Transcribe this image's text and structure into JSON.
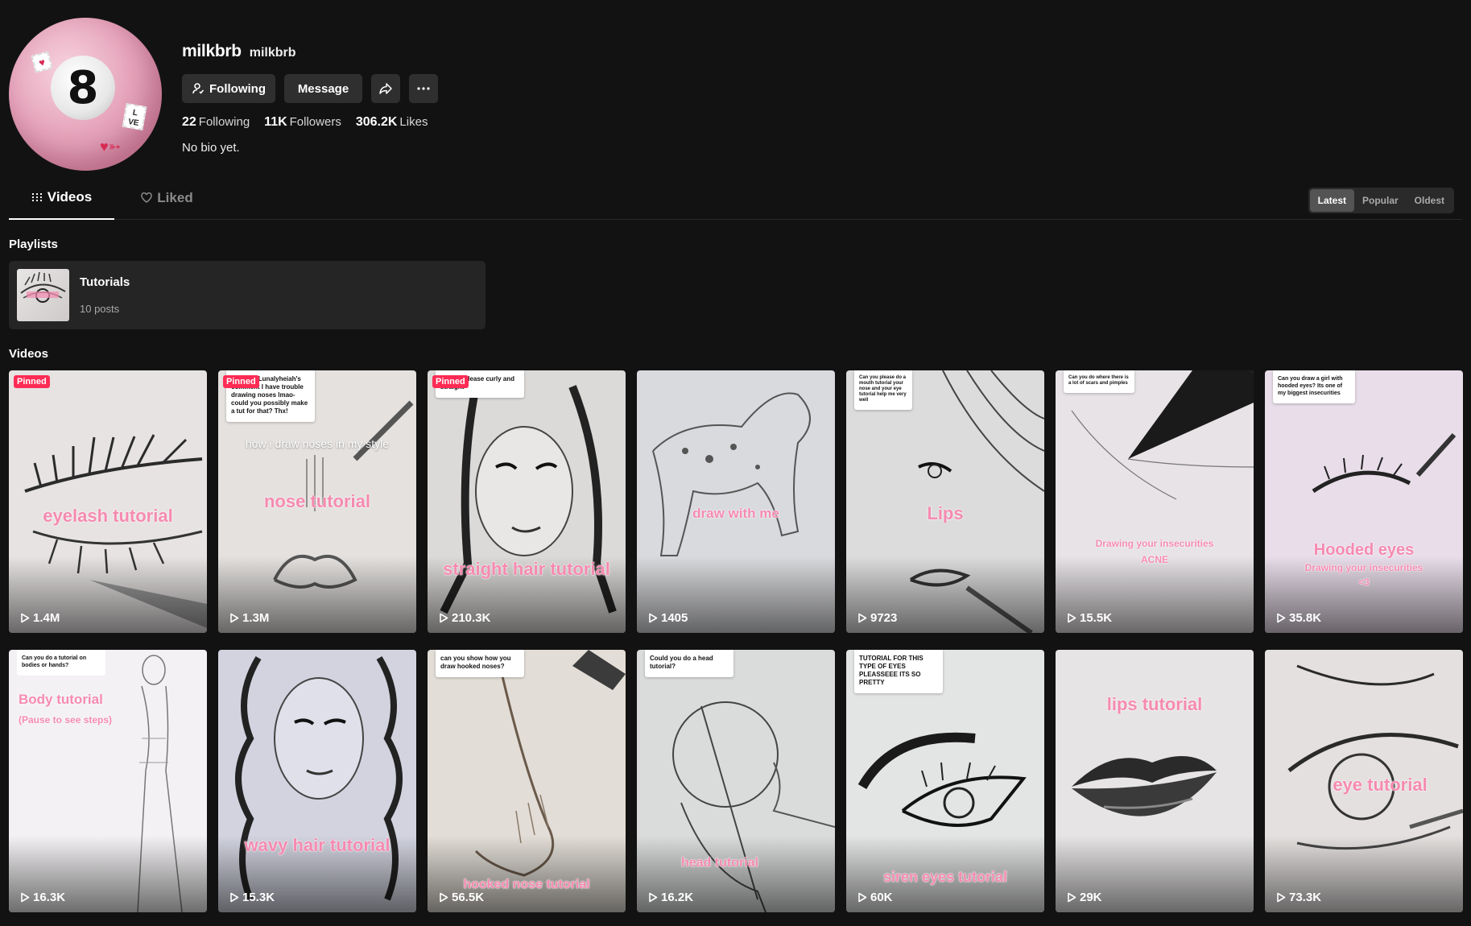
{
  "profile": {
    "display_name": "milkbrb",
    "username": "milkbrb",
    "bio": "No bio yet.",
    "stats": {
      "following_value": "22",
      "following_label": "Following",
      "followers_value": "11K",
      "followers_label": "Followers",
      "likes_value": "306.2K",
      "likes_label": "Likes"
    },
    "actions": {
      "following_label": "Following",
      "message_label": "Message"
    }
  },
  "tabs": [
    {
      "label": "Videos",
      "icon": "grid-icon",
      "active": true
    },
    {
      "label": "Liked",
      "icon": "heart-icon",
      "active": false
    }
  ],
  "sort": {
    "options": [
      "Latest",
      "Popular",
      "Oldest"
    ],
    "selected": "Latest"
  },
  "playlists": {
    "title": "Playlists",
    "items": [
      {
        "name": "Tutorials",
        "count": "10 posts"
      }
    ]
  },
  "videos": {
    "title": "Videos",
    "pinned_label": "Pinned",
    "items": [
      {
        "views": "1.4M",
        "pinned": true,
        "overlay": "eyelash tutorial",
        "comment": ""
      },
      {
        "views": "1.3M",
        "pinned": true,
        "overlay": "nose tutorial",
        "overlay2": "how i draw noses in my style",
        "comment": "Reply to Lunalyheiah's comment\nI have trouble drawing noses lmao-could you possibly make a tut for that? Thx!"
      },
      {
        "views": "210.3K",
        "pinned": true,
        "overlay": "straight hair tutorial",
        "comment": "tutorial please curly and straight"
      },
      {
        "views": "1405",
        "pinned": false,
        "overlay": "draw with me",
        "comment": ""
      },
      {
        "views": "9723",
        "pinned": false,
        "overlay": "Lips",
        "comment": "Can you please do a mouth tutorial your nose and your eye tutorial help me very well"
      },
      {
        "views": "15.5K",
        "pinned": false,
        "overlay": "Drawing your insecurities",
        "overlay2": "ACNE",
        "comment": "Can you do where there is a lot of scars and pimples"
      },
      {
        "views": "35.8K",
        "pinned": false,
        "overlay": "Hooded eyes",
        "overlay2": "Drawing your insecurities",
        "overlay3": "<3",
        "comment": "Can you draw a girl with hooded eyes? Its one of my biggest insecurities"
      },
      {
        "views": "16.3K",
        "pinned": false,
        "overlay": "Body tutorial",
        "overlay2": "(Pause to see steps)",
        "comment": "Can you do a tutorial on bodies or hands?"
      },
      {
        "views": "15.3K",
        "pinned": false,
        "overlay": "wavy hair tutorial",
        "comment": ""
      },
      {
        "views": "56.5K",
        "pinned": false,
        "overlay": "hooked nose tutorial",
        "comment": "can you show how you draw hooked noses?"
      },
      {
        "views": "16.2K",
        "pinned": false,
        "overlay": "head tutorial",
        "comment": "Could you do a head tutorial?"
      },
      {
        "views": "60K",
        "pinned": false,
        "overlay": "siren eyes tutorial",
        "comment": "TUTORIAL FOR THIS TYPE OF EYES PLEASSEEE ITS SO PRETTY"
      },
      {
        "views": "29K",
        "pinned": false,
        "overlay": "lips tutorial",
        "comment": ""
      },
      {
        "views": "73.3K",
        "pinned": false,
        "overlay": "eye tutorial",
        "comment": ""
      }
    ]
  },
  "colors": {
    "background": "#121212",
    "button_bg": "#2f2f2f",
    "pinned_badge": "#fe2c55",
    "overlay_pink": "#f58ab0"
  }
}
